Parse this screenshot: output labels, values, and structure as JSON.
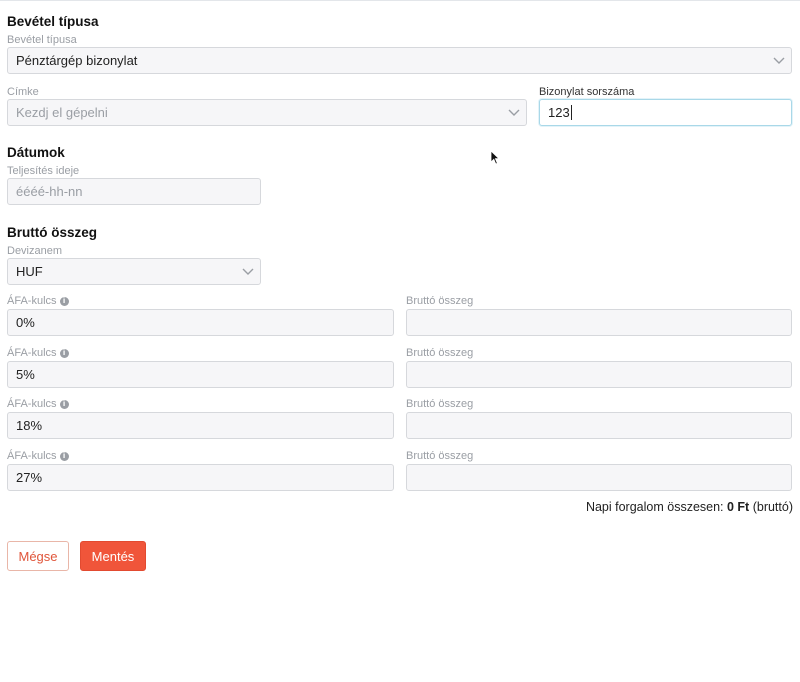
{
  "income_type": {
    "title": "Bevétel típusa",
    "type_label": "Bevétel típusa",
    "type_value": "Pénztárgép bizonylat",
    "tag_label": "Címke",
    "tag_placeholder": "Kezdj el gépelni",
    "receipt_label": "Bizonylat sorszáma",
    "receipt_value": "123"
  },
  "dates": {
    "title": "Dátumok",
    "performance_label": "Teljesítés ideje",
    "performance_placeholder": "éééé-hh-nn"
  },
  "gross": {
    "title": "Bruttó összeg",
    "currency_label": "Devizanem",
    "currency_value": "HUF",
    "rows": [
      {
        "vat_label": "ÁFA-kulcs",
        "vat_value": "0%",
        "gross_label": "Bruttó összeg",
        "gross_value": ""
      },
      {
        "vat_label": "ÁFA-kulcs",
        "vat_value": "5%",
        "gross_label": "Bruttó összeg",
        "gross_value": ""
      },
      {
        "vat_label": "ÁFA-kulcs",
        "vat_value": "18%",
        "gross_label": "Bruttó összeg",
        "gross_value": ""
      },
      {
        "vat_label": "ÁFA-kulcs",
        "vat_value": "27%",
        "gross_label": "Bruttó összeg",
        "gross_value": ""
      }
    ],
    "summary_prefix": "Napi forgalom összesen: ",
    "summary_amount": "0 Ft",
    "summary_suffix": " (bruttó)"
  },
  "actions": {
    "cancel_label": "Mégse",
    "save_label": "Mentés"
  },
  "icons": {
    "info": "info-icon",
    "chevron": "chevron-down-icon",
    "cursor": "mouse-pointer-icon"
  },
  "colors": {
    "accent": "#f0553a",
    "focus_border": "#a9d8e8"
  }
}
